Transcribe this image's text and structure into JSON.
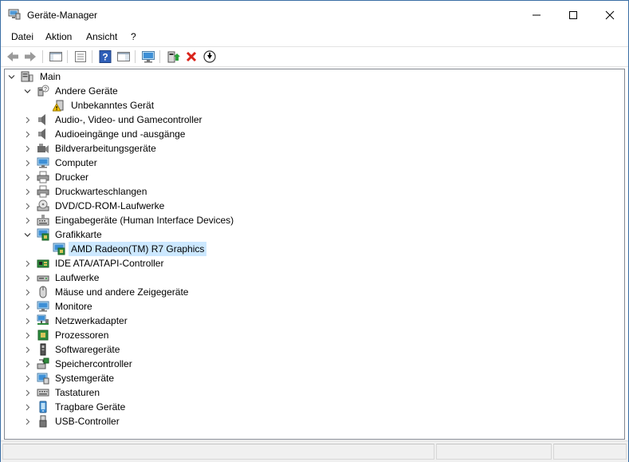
{
  "window": {
    "title": "Geräte-Manager",
    "app_icon": "device-manager-icon"
  },
  "menu": {
    "items": [
      "Datei",
      "Aktion",
      "Ansicht",
      "?"
    ]
  },
  "toolbar": {
    "buttons": [
      "back-icon",
      "forward-icon",
      "show-hide-console-tree-icon",
      "properties-icon",
      "help-icon",
      "show-hide-action-pane-icon",
      "scan-hardware-icon",
      "update-driver-icon",
      "uninstall-icon",
      "disable-device-icon"
    ]
  },
  "tree": {
    "root": "Main",
    "items": [
      {
        "label": "Andere Geräte",
        "icon": "unknown-device-icon",
        "expanded": true
      },
      {
        "label": "Unbekanntes Gerät",
        "icon": "warning-device-icon",
        "child": true
      },
      {
        "label": "Audio-, Video- und Gamecontroller",
        "icon": "speaker-icon"
      },
      {
        "label": "Audioeingänge und -ausgänge",
        "icon": "speaker-icon"
      },
      {
        "label": "Bildverarbeitungsgeräte",
        "icon": "camera-icon"
      },
      {
        "label": "Computer",
        "icon": "computer-icon"
      },
      {
        "label": "Drucker",
        "icon": "printer-icon"
      },
      {
        "label": "Druckwarteschlangen",
        "icon": "printer-icon"
      },
      {
        "label": "DVD/CD-ROM-Laufwerke",
        "icon": "optical-drive-icon"
      },
      {
        "label": "Eingabegeräte (Human Interface Devices)",
        "icon": "hid-icon"
      },
      {
        "label": "Grafikkarte",
        "icon": "display-adapter-icon",
        "expanded": true
      },
      {
        "label": "AMD Radeon(TM) R7 Graphics",
        "icon": "display-adapter-icon",
        "child": true,
        "selected": true
      },
      {
        "label": "IDE ATA/ATAPI-Controller",
        "icon": "controller-icon"
      },
      {
        "label": "Laufwerke",
        "icon": "disk-drive-icon"
      },
      {
        "label": "Mäuse und andere Zeigegeräte",
        "icon": "mouse-icon"
      },
      {
        "label": "Monitore",
        "icon": "monitor-icon"
      },
      {
        "label": "Netzwerkadapter",
        "icon": "network-icon"
      },
      {
        "label": "Prozessoren",
        "icon": "processor-icon"
      },
      {
        "label": "Softwaregeräte",
        "icon": "software-device-icon"
      },
      {
        "label": "Speichercontroller",
        "icon": "storage-controller-icon"
      },
      {
        "label": "Systemgeräte",
        "icon": "system-device-icon"
      },
      {
        "label": "Tastaturen",
        "icon": "keyboard-icon"
      },
      {
        "label": "Tragbare Geräte",
        "icon": "portable-device-icon"
      },
      {
        "label": "USB-Controller",
        "icon": "usb-icon"
      }
    ]
  },
  "colors": {
    "selection": "#cce8ff",
    "accent_blue": "#1f7fd6",
    "uninstall_red": "#d9231a"
  }
}
